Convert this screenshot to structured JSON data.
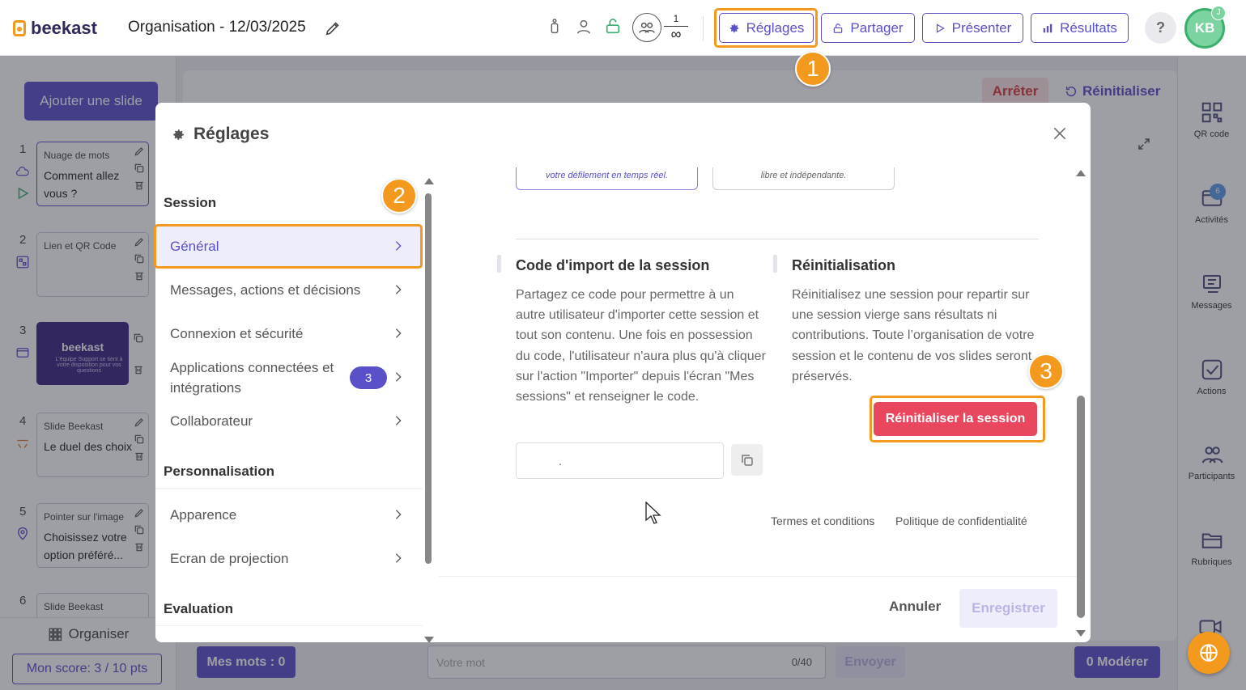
{
  "app": {
    "logo_text": "beekast",
    "session_title": "Organisation - 12/03/2025"
  },
  "header": {
    "participants_count": "1",
    "participants_limit": "∞",
    "buttons": {
      "settings": "Réglages",
      "share": "Partager",
      "present": "Présenter",
      "results": "Résultats"
    },
    "help": "?",
    "avatar_initials": "KB",
    "avatar_badge": "J"
  },
  "steps": {
    "one": "1",
    "two": "2",
    "three": "3"
  },
  "left_panel": {
    "add_slide": "Ajouter une slide",
    "slides": [
      {
        "num": "1",
        "type": "Nuage de mots",
        "title": "Comment allez vous ?"
      },
      {
        "num": "2",
        "type": "Lien et QR Code",
        "title": ""
      },
      {
        "num": "3",
        "type": "",
        "title": "",
        "brand": "beekast",
        "subtitle": "L'équipe Support se tient à votre disposition pour vos questions"
      },
      {
        "num": "4",
        "type": "Slide Beekast",
        "title": "Le duel des choix"
      },
      {
        "num": "5",
        "type": "Pointer sur l'image",
        "title": "Choisissez votre option préféré..."
      },
      {
        "num": "6",
        "type": "Slide Beekast",
        "title": ""
      }
    ],
    "organise": "Organiser",
    "score": "Mon score: 3 / 10 pts"
  },
  "main": {
    "stop": "Arrêter",
    "reset": "Réinitialiser"
  },
  "right_rail": {
    "items": [
      "QR code",
      "Activités",
      "Messages",
      "Actions",
      "Participants",
      "Rubriques"
    ],
    "activities_badge": "6"
  },
  "bottom_bar": {
    "my_words": "Mes mots : 0",
    "word_placeholder": "Votre mot",
    "word_count": "0/40",
    "send": "Envoyer",
    "moderate": "0 Modérer"
  },
  "modal": {
    "title": "Réglages",
    "nav": {
      "sections": [
        "Session",
        "Personnalisation",
        "Evaluation"
      ],
      "session_items": [
        "Général",
        "Messages, actions et décisions",
        "Connexion et sécurité",
        "Applications connectées et intégrations",
        "Collaborateur"
      ],
      "integrations_badge": "3",
      "custom_items": [
        "Apparence",
        "Ecran de projection"
      ]
    },
    "cards_top": [
      "votre défilement en temps réel.",
      "libre et indépendante."
    ],
    "import": {
      "title": "Code d'import de la session",
      "text": "Partagez ce code pour permettre à un autre utilisateur d'importer cette session et tout son contenu. Une fois en possession du code, l'utilisateur n'aura plus qu'à cliquer sur l'action \"Importer\" depuis l'écran \"Mes sessions\" et renseigner le code.",
      "code_value": "."
    },
    "reset": {
      "title": "Réinitialisation",
      "text": "Réinitialisez une session pour repartir sur une session vierge sans résultats ni contributions. Toute l’organisation de votre session et le contenu de vos slides seront préservés.",
      "button": "Réinitialiser la session"
    },
    "links": {
      "terms": "Termes et conditions",
      "privacy": "Politique de confidentialité"
    },
    "footer": {
      "cancel": "Annuler",
      "save": "Enregistrer"
    }
  },
  "colors": {
    "primary": "#5a50c8",
    "accent": "#f39a1e",
    "danger": "#e8475e"
  },
  "icons": [
    "pencil-icon",
    "accessibility-icon",
    "user-icon",
    "lock-icon",
    "participants-icon",
    "gear-icon",
    "unlock-icon",
    "play-icon",
    "bar-chart-icon",
    "close-icon",
    "chevron-right-icon",
    "copy-icon",
    "qr-code-icon",
    "messages-icon",
    "check-icon",
    "folder-icon",
    "support-icon",
    "cursor-icon"
  ]
}
